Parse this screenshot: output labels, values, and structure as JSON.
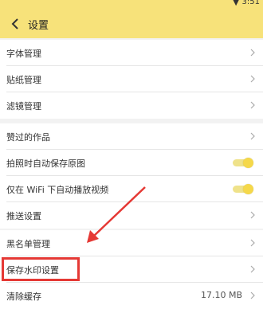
{
  "status_bar": {
    "time": "3:51"
  },
  "header": {
    "title": "设置"
  },
  "rows": [
    {
      "label": "字体管理"
    },
    {
      "label": "贴纸管理"
    },
    {
      "label": "滤镜管理"
    },
    {
      "label": "赞过的作品"
    },
    {
      "label": "拍照时自动保存原图",
      "toggle_on": true
    },
    {
      "label": "仅在 WiFi 下自动播放视频",
      "toggle_on": true
    },
    {
      "label": "推送设置"
    },
    {
      "label": "黑名单管理"
    },
    {
      "label": "保存水印设置"
    },
    {
      "label": "清除缓存",
      "value": "17.10 MB"
    }
  ],
  "colors": {
    "header_bg": "#f7e27a",
    "annotation_red": "#e53935",
    "toggle_on": "#f5d84a"
  }
}
